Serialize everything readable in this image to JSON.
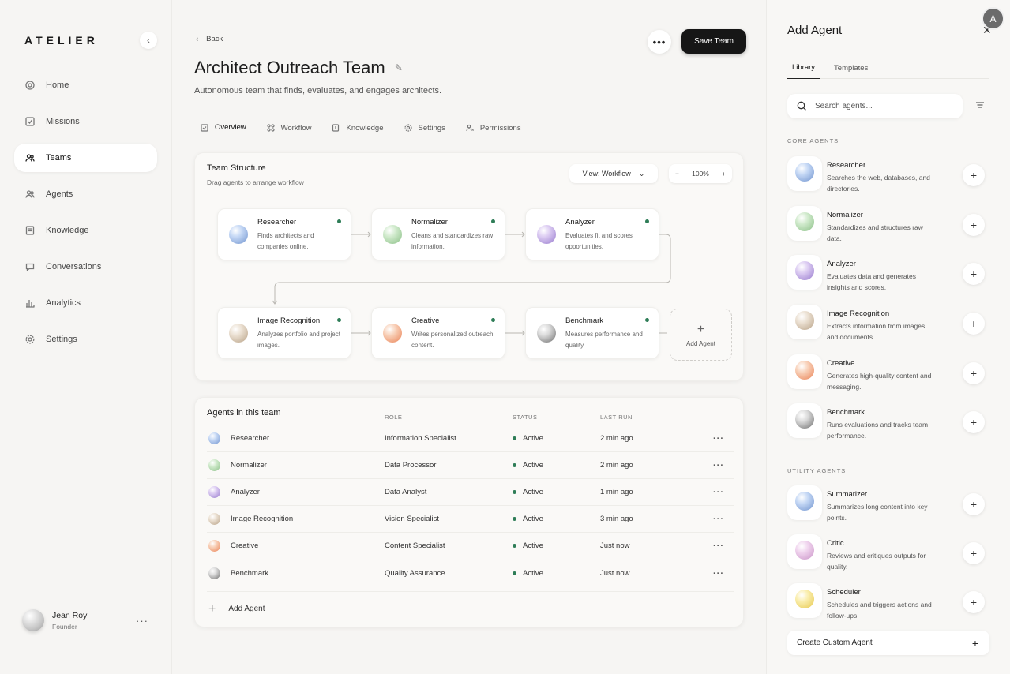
{
  "sidebar": {
    "logo": "ATELIER",
    "collapse_icon": "‹",
    "items": [
      {
        "label": "Home",
        "icon": "home-icon"
      },
      {
        "label": "Missions",
        "icon": "missions-icon"
      },
      {
        "label": "Teams",
        "icon": "teams-icon",
        "active": true
      },
      {
        "label": "Agents",
        "icon": "agents-icon"
      },
      {
        "label": "Knowledge",
        "icon": "knowledge-icon"
      },
      {
        "label": "Conversations",
        "icon": "conversations-icon"
      },
      {
        "label": "Analytics",
        "icon": "analytics-icon"
      },
      {
        "label": "Settings",
        "icon": "settings-icon"
      }
    ],
    "user": {
      "name": "Jean Roy",
      "role": "Founder",
      "more": "···"
    }
  },
  "header": {
    "back_label": "Back",
    "more": "•••",
    "save_label": "Save Team",
    "title": "Architect Outreach Team",
    "subtitle": "Autonomous team that finds, evaluates, and engages architects."
  },
  "tabs": [
    {
      "label": "Overview",
      "active": true
    },
    {
      "label": "Workflow"
    },
    {
      "label": "Knowledge"
    },
    {
      "label": "Settings"
    },
    {
      "label": "Permissions"
    }
  ],
  "structure": {
    "title": "Team Structure",
    "subtitle": "Drag agents to arrange workflow",
    "view_label": "View: Workflow",
    "zoom_minus": "−",
    "zoom_value": "100%",
    "zoom_plus": "+",
    "nodes": [
      {
        "name": "Researcher",
        "desc": "Finds architects and companies online.",
        "color": "blue"
      },
      {
        "name": "Normalizer",
        "desc": "Cleans and standardizes raw information.",
        "color": "green"
      },
      {
        "name": "Analyzer",
        "desc": "Evaluates fit and scores opportunities.",
        "color": "purple"
      },
      {
        "name": "Image Recognition",
        "desc": "Analyzes portfolio and project images.",
        "color": "beige"
      },
      {
        "name": "Creative",
        "desc": "Writes personalized outreach content.",
        "color": "orange"
      },
      {
        "name": "Benchmark",
        "desc": "Measures performance and quality.",
        "color": "gray"
      }
    ],
    "add_label": "Add Agent"
  },
  "team_table": {
    "title": "Agents in this team",
    "columns": [
      "ROLE",
      "STATUS",
      "LAST RUN"
    ],
    "rows": [
      {
        "name": "Researcher",
        "role": "Information Specialist",
        "status": "Active",
        "last_run": "2 min ago",
        "color": "blue"
      },
      {
        "name": "Normalizer",
        "role": "Data Processor",
        "status": "Active",
        "last_run": "2 min ago",
        "color": "green"
      },
      {
        "name": "Analyzer",
        "role": "Data Analyst",
        "status": "Active",
        "last_run": "1 min ago",
        "color": "purple"
      },
      {
        "name": "Image Recognition",
        "role": "Vision Specialist",
        "status": "Active",
        "last_run": "3 min ago",
        "color": "beige"
      },
      {
        "name": "Creative",
        "role": "Content Specialist",
        "status": "Active",
        "last_run": "Just now",
        "color": "orange"
      },
      {
        "name": "Benchmark",
        "role": "Quality Assurance",
        "status": "Active",
        "last_run": "Just now",
        "color": "gray"
      }
    ],
    "add_label": "Add Agent"
  },
  "panel": {
    "title": "Add Agent",
    "tabs": [
      {
        "label": "Library",
        "active": true
      },
      {
        "label": "Templates"
      }
    ],
    "search_placeholder": "Search agents...",
    "core_label": "CORE AGENTS",
    "core": [
      {
        "name": "Researcher",
        "desc": "Searches the web, databases, and directories.",
        "color": "blue"
      },
      {
        "name": "Normalizer",
        "desc": "Standardizes and structures raw data.",
        "color": "green"
      },
      {
        "name": "Analyzer",
        "desc": "Evaluates data and generates insights and scores.",
        "color": "purple"
      },
      {
        "name": "Image Recognition",
        "desc": "Extracts information from images and documents.",
        "color": "beige"
      },
      {
        "name": "Creative",
        "desc": "Generates high-quality content and messaging.",
        "color": "orange"
      },
      {
        "name": "Benchmark",
        "desc": "Runs evaluations and tracks team performance.",
        "color": "gray"
      }
    ],
    "utility_label": "UTILITY AGENTS",
    "utility": [
      {
        "name": "Summarizer",
        "desc": "Summarizes long content into key points.",
        "color": "blue"
      },
      {
        "name": "Critic",
        "desc": "Reviews and critiques outputs for quality.",
        "color": "pink"
      },
      {
        "name": "Scheduler",
        "desc": "Schedules and triggers actions and follow-ups.",
        "color": "yellow"
      }
    ],
    "custom_label": "Create Custom Agent"
  },
  "colors": {
    "accent": "#161616",
    "status_active": "#2e7d57",
    "background": "#f6f5f3"
  }
}
